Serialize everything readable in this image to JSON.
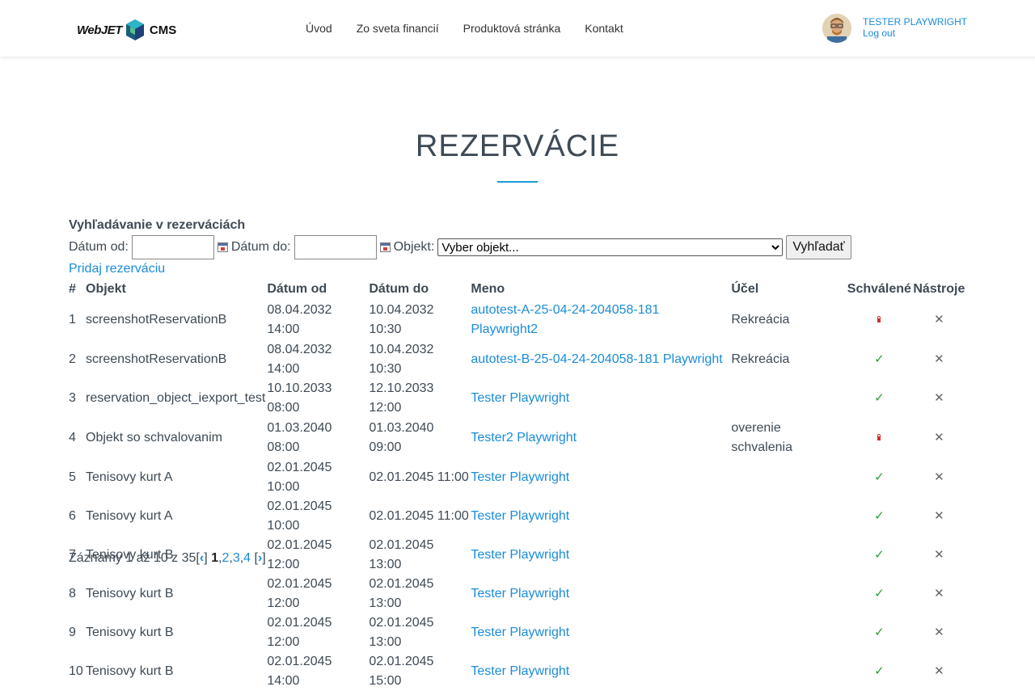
{
  "header": {
    "logo_left": "WebJET",
    "logo_right": "CMS",
    "nav": [
      "Úvod",
      "Zo sveta financií",
      "Produktová stránka",
      "Kontakt"
    ],
    "user_name": "TESTER PLAYWRIGHT",
    "logout": "Log out"
  },
  "page": {
    "title": "REZERVÁCIE",
    "accent_color": "#1a9bd7",
    "link_color": "#1a8cd8"
  },
  "search": {
    "heading": "Vyhľadávanie v rezerváciách",
    "date_from_label": "Dátum od:",
    "date_to_label": "Dátum do:",
    "object_label": "Objekt:",
    "object_selected": "Vyber objekt...",
    "button": "Vyhľadať",
    "add_link": "Pridaj rezerváciu"
  },
  "table": {
    "headers": [
      "#",
      "Objekt",
      "Dátum od",
      "Dátum do",
      "Meno",
      "Účel",
      "Schválené",
      "Nástroje"
    ],
    "rows": [
      {
        "n": "1",
        "obj": "screenshotReservationB",
        "od": "08.04.2032 14:00",
        "do": "10.04.2032 10:30",
        "meno": "autotest-A-25-04-24-204058-181 Playwright2",
        "ucel": "Rekreácia",
        "approved": false
      },
      {
        "n": "2",
        "obj": "screenshotReservationB",
        "od": "08.04.2032 14:00",
        "do": "10.04.2032 10:30",
        "meno": "autotest-B-25-04-24-204058-181 Playwright",
        "ucel": "Rekreácia",
        "approved": true
      },
      {
        "n": "3",
        "obj": "reservation_object_iexport_test",
        "od": "10.10.2033 08:00",
        "do": "12.10.2033 12:00",
        "meno": "Tester Playwright",
        "ucel": "",
        "approved": true
      },
      {
        "n": "4",
        "obj": "Objekt so schvalovanim",
        "od": "01.03.2040 08:00",
        "do": "01.03.2040 09:00",
        "meno": "Tester2 Playwright",
        "ucel": "overenie schvalenia",
        "approved": false
      },
      {
        "n": "5",
        "obj": "Tenisovy kurt A",
        "od": "02.01.2045 10:00",
        "do": "02.01.2045 11:00",
        "meno": "Tester Playwright",
        "ucel": "",
        "approved": true
      },
      {
        "n": "6",
        "obj": "Tenisovy kurt A",
        "od": "02.01.2045 10:00",
        "do": "02.01.2045 11:00",
        "meno": "Tester Playwright",
        "ucel": "",
        "approved": true
      },
      {
        "n": "7",
        "obj": "Tenisovy kurt B",
        "od": "02.01.2045 12:00",
        "do": "02.01.2045 13:00",
        "meno": "Tester Playwright",
        "ucel": "",
        "approved": true
      },
      {
        "n": "8",
        "obj": "Tenisovy kurt B",
        "od": "02.01.2045 12:00",
        "do": "02.01.2045 13:00",
        "meno": "Tester Playwright",
        "ucel": "",
        "approved": true
      },
      {
        "n": "9",
        "obj": "Tenisovy kurt B",
        "od": "02.01.2045 12:00",
        "do": "02.01.2045 13:00",
        "meno": "Tester Playwright",
        "ucel": "",
        "approved": true
      },
      {
        "n": "10",
        "obj": "Tenisovy kurt B",
        "od": "02.01.2045 14:00",
        "do": "02.01.2045 15:00",
        "meno": "Tester Playwright",
        "ucel": "",
        "approved": true
      }
    ],
    "approved_icon": "checkmark-icon",
    "pending_icon": "lock-icon",
    "delete_icon": "delete-icon"
  },
  "pager": {
    "summary": "Záznamy 1 až 10 z 35",
    "current": "1",
    "pages": [
      "2",
      "3",
      "4"
    ]
  }
}
